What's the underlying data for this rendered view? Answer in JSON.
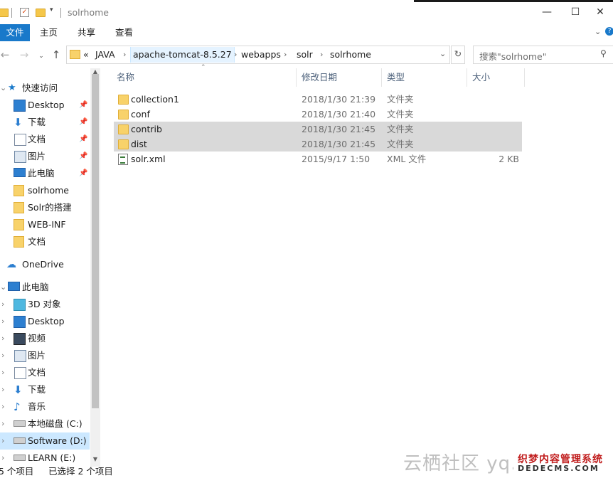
{
  "window": {
    "title": "solrhome",
    "controls": {
      "minimize": "—",
      "maximize": "☐",
      "close": "✕"
    }
  },
  "ribbon": {
    "tabs": [
      "文件",
      "主页",
      "共享",
      "查看"
    ],
    "expand_icon": "chevron-down-icon",
    "help_icon": "help-icon"
  },
  "address": {
    "overflow": "«",
    "crumbs": [
      "JAVA",
      "apache-tomcat-8.5.27",
      "webapps",
      "solr",
      "solrhome"
    ],
    "search_placeholder": "搜索\"solrhome\""
  },
  "sidebar": {
    "quick_access": "快速访问",
    "quick_items": [
      {
        "label": "Desktop",
        "icon": "desktop-icon",
        "pinned": true
      },
      {
        "label": "下载",
        "icon": "download-icon",
        "pinned": true
      },
      {
        "label": "文档",
        "icon": "documents-icon",
        "pinned": true
      },
      {
        "label": "图片",
        "icon": "pictures-icon",
        "pinned": true
      },
      {
        "label": "此电脑",
        "icon": "pc-icon",
        "pinned": true
      },
      {
        "label": "solrhome",
        "icon": "folder-icon",
        "pinned": false
      },
      {
        "label": "Solr的搭建",
        "icon": "folder-icon",
        "pinned": false
      },
      {
        "label": "WEB-INF",
        "icon": "folder-icon",
        "pinned": false
      },
      {
        "label": "文档",
        "icon": "folder-icon",
        "pinned": false
      }
    ],
    "onedrive": "OneDrive",
    "this_pc": "此电脑",
    "pc_items": [
      {
        "label": "3D 对象",
        "icon": "3d-objects-icon"
      },
      {
        "label": "Desktop",
        "icon": "desktop-icon"
      },
      {
        "label": "视频",
        "icon": "videos-icon"
      },
      {
        "label": "图片",
        "icon": "pictures-icon"
      },
      {
        "label": "文档",
        "icon": "documents-icon"
      },
      {
        "label": "下载",
        "icon": "download-icon"
      },
      {
        "label": "音乐",
        "icon": "music-icon"
      },
      {
        "label": "本地磁盘 (C:)",
        "icon": "drive-icon"
      },
      {
        "label": "Software (D:)",
        "icon": "drive-icon",
        "selected": true
      },
      {
        "label": "LEARN (E:)",
        "icon": "drive-icon"
      }
    ]
  },
  "columns": {
    "name": "名称",
    "date": "修改日期",
    "type": "类型",
    "size": "大小"
  },
  "files": [
    {
      "name": "collection1",
      "date": "2018/1/30 21:39",
      "type": "文件夹",
      "size": "",
      "kind": "folder",
      "selected": false
    },
    {
      "name": "conf",
      "date": "2018/1/30 21:40",
      "type": "文件夹",
      "size": "",
      "kind": "folder",
      "selected": false
    },
    {
      "name": "contrib",
      "date": "2018/1/30 21:45",
      "type": "文件夹",
      "size": "",
      "kind": "folder",
      "selected": true
    },
    {
      "name": "dist",
      "date": "2018/1/30 21:45",
      "type": "文件夹",
      "size": "",
      "kind": "folder",
      "selected": true
    },
    {
      "name": "solr.xml",
      "date": "2015/9/17 1:50",
      "type": "XML 文件",
      "size": "2 KB",
      "kind": "xml",
      "selected": false
    }
  ],
  "status": {
    "count": "5 个项目",
    "selected": "已选择 2 个项目"
  },
  "watermarks": {
    "yunqi": "云栖社区 yq.ali",
    "dede_cn": "织梦内容管理系统",
    "dede_en": "DEDECMS.COM"
  },
  "colors": {
    "accent": "#1979ca",
    "selection": "#d9d9d9",
    "nav_selected": "#cce8ff"
  }
}
